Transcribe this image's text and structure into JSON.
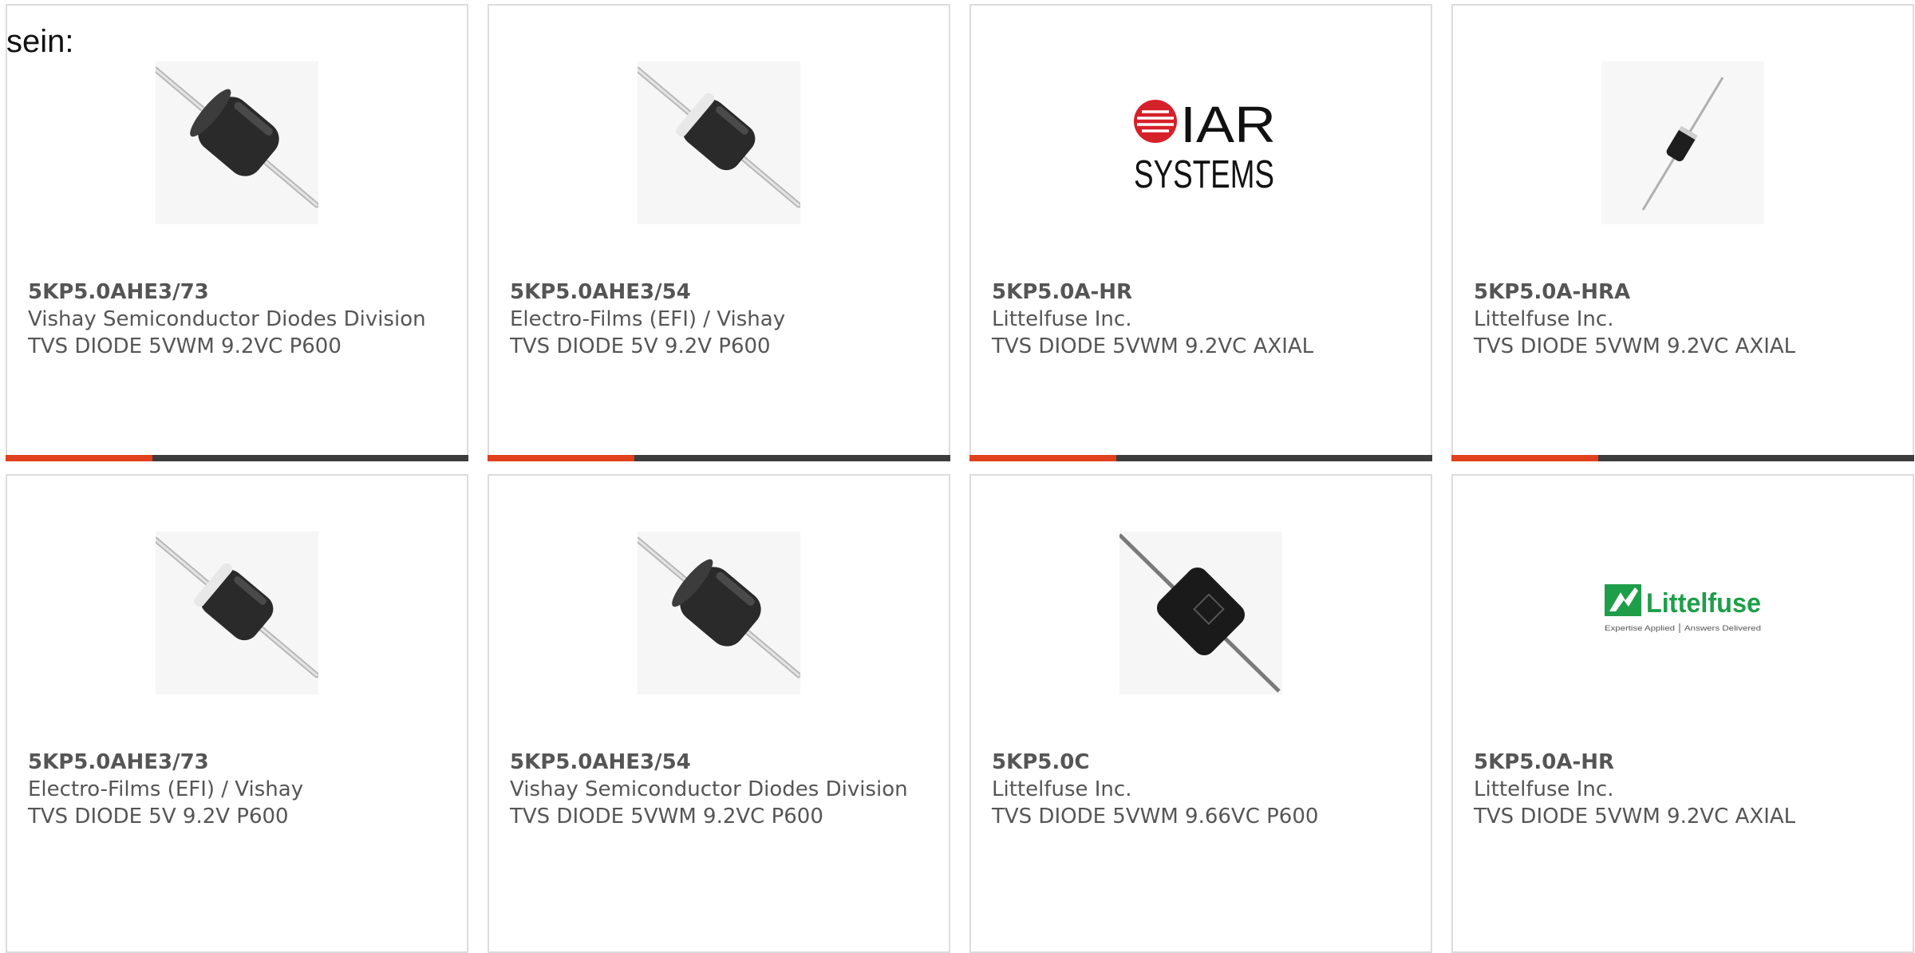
{
  "lead_text": "sein:",
  "colors": {
    "accent": "#e0401c",
    "bar": "#3d3d3d",
    "text": "#555555",
    "border": "#dcdcdc"
  },
  "products": [
    {
      "part_number": "5KP5.0AHE3/73",
      "manufacturer": "Vishay Semiconductor Diodes Division",
      "description": "TVS DIODE 5VWM 9.2VC P600",
      "image": "diode-tilted-icon"
    },
    {
      "part_number": "5KP5.0AHE3/54",
      "manufacturer": "Electro-Films (EFI) / Vishay",
      "description": "TVS DIODE 5V 9.2V P600",
      "image": "diode-banded-icon"
    },
    {
      "part_number": "5KP5.0A-HR",
      "manufacturer": "Littelfuse Inc.",
      "description": "TVS DIODE 5VWM 9.2VC AXIAL",
      "image": "iar-systems-logo",
      "logo_text": [
        "IAR",
        "SYSTEMS"
      ]
    },
    {
      "part_number": "5KP5.0A-HRA",
      "manufacturer": "Littelfuse Inc.",
      "description": "TVS DIODE 5VWM 9.2VC AXIAL",
      "image": "diode-small-icon"
    },
    {
      "part_number": "5KP5.0AHE3/73",
      "manufacturer": "Electro-Films (EFI) / Vishay",
      "description": "TVS DIODE 5V 9.2V P600",
      "image": "diode-banded-icon"
    },
    {
      "part_number": "5KP5.0AHE3/54",
      "manufacturer": "Vishay Semiconductor Diodes Division",
      "description": "TVS DIODE 5VWM 9.2VC P600",
      "image": "diode-tilted-icon"
    },
    {
      "part_number": "5KP5.0C",
      "manufacturer": "Littelfuse Inc.",
      "description": "TVS DIODE 5VWM 9.66VC P600",
      "image": "diode-axial-icon"
    },
    {
      "part_number": "5KP5.0A-HR",
      "manufacturer": "Littelfuse Inc.",
      "description": "TVS DIODE 5VWM 9.2VC AXIAL",
      "image": "littelfuse-logo",
      "logo_text": [
        "Littelfuse",
        "Expertise Applied",
        "Answers Delivered"
      ]
    }
  ]
}
